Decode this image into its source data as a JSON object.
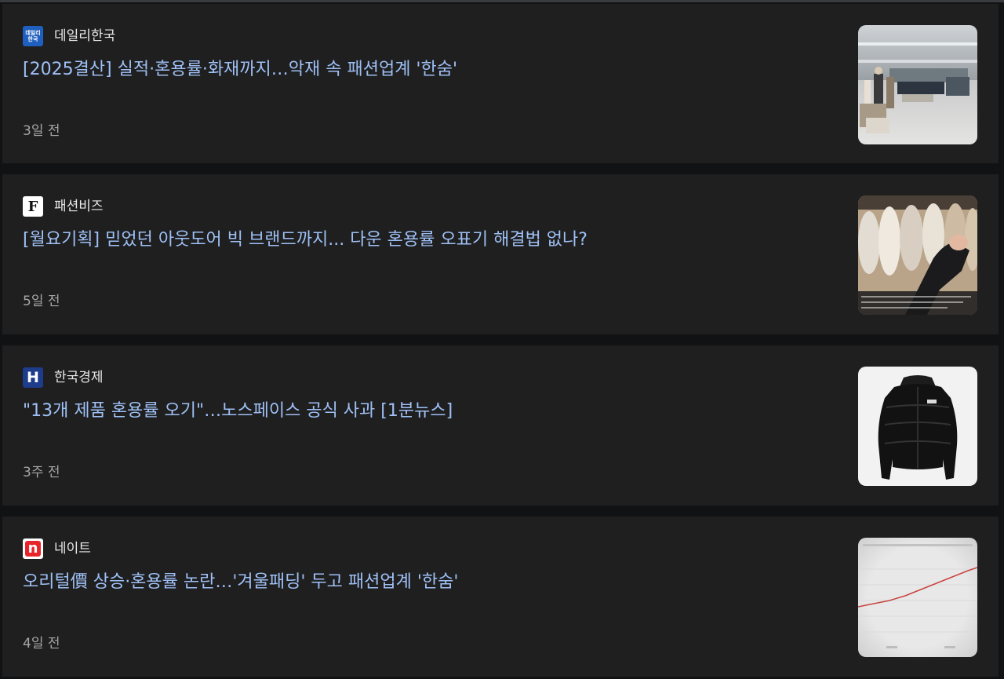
{
  "articles": [
    {
      "source": "데일리한국",
      "logo_text": [
        "데일리",
        "한국"
      ],
      "logo_color": "#1f5fbf",
      "logo_icon": "dailyhankook-logo-icon",
      "headline": "[2025결산] 실적·혼용률·화재까지…악재 속 패션업계 '한숨'",
      "time": "3일 전",
      "thumbnail": "store-interior-thumbnail"
    },
    {
      "source": "패션비즈",
      "logo_text": [
        "F"
      ],
      "logo_color": "#ffffff",
      "logo_icon": "fashionbiz-logo-icon",
      "headline": "[월요기획] 믿었던 아웃도어 빅 브랜드까지... 다운 혼용률 오표기 해결법 없나?",
      "time": "5일 전",
      "thumbnail": "down-jackets-rack-thumbnail"
    },
    {
      "source": "한국경제",
      "logo_text": [
        "H"
      ],
      "logo_color": "#1d3c8c",
      "logo_icon": "hankyung-logo-icon",
      "headline": "\"13개 제품 혼용률 오기\"…노스페이스 공식 사과 [1분뉴스]",
      "time": "3주 전",
      "thumbnail": "black-puffer-jacket-thumbnail"
    },
    {
      "source": "네이트",
      "logo_text": [
        "n"
      ],
      "logo_color": "#e8242b",
      "logo_icon": "nate-logo-icon",
      "headline": "오리털價 상승·혼용률 논란…'겨울패딩' 두고 패션업계 '한숨'",
      "time": "4일 전",
      "thumbnail": "price-trend-chart-thumbnail"
    }
  ],
  "colors": {
    "page_background": "#111214",
    "card_background": "#1f1f20",
    "headline": "#9fc0f5",
    "source": "#e8e8e8",
    "time": "#a6a6a6"
  }
}
